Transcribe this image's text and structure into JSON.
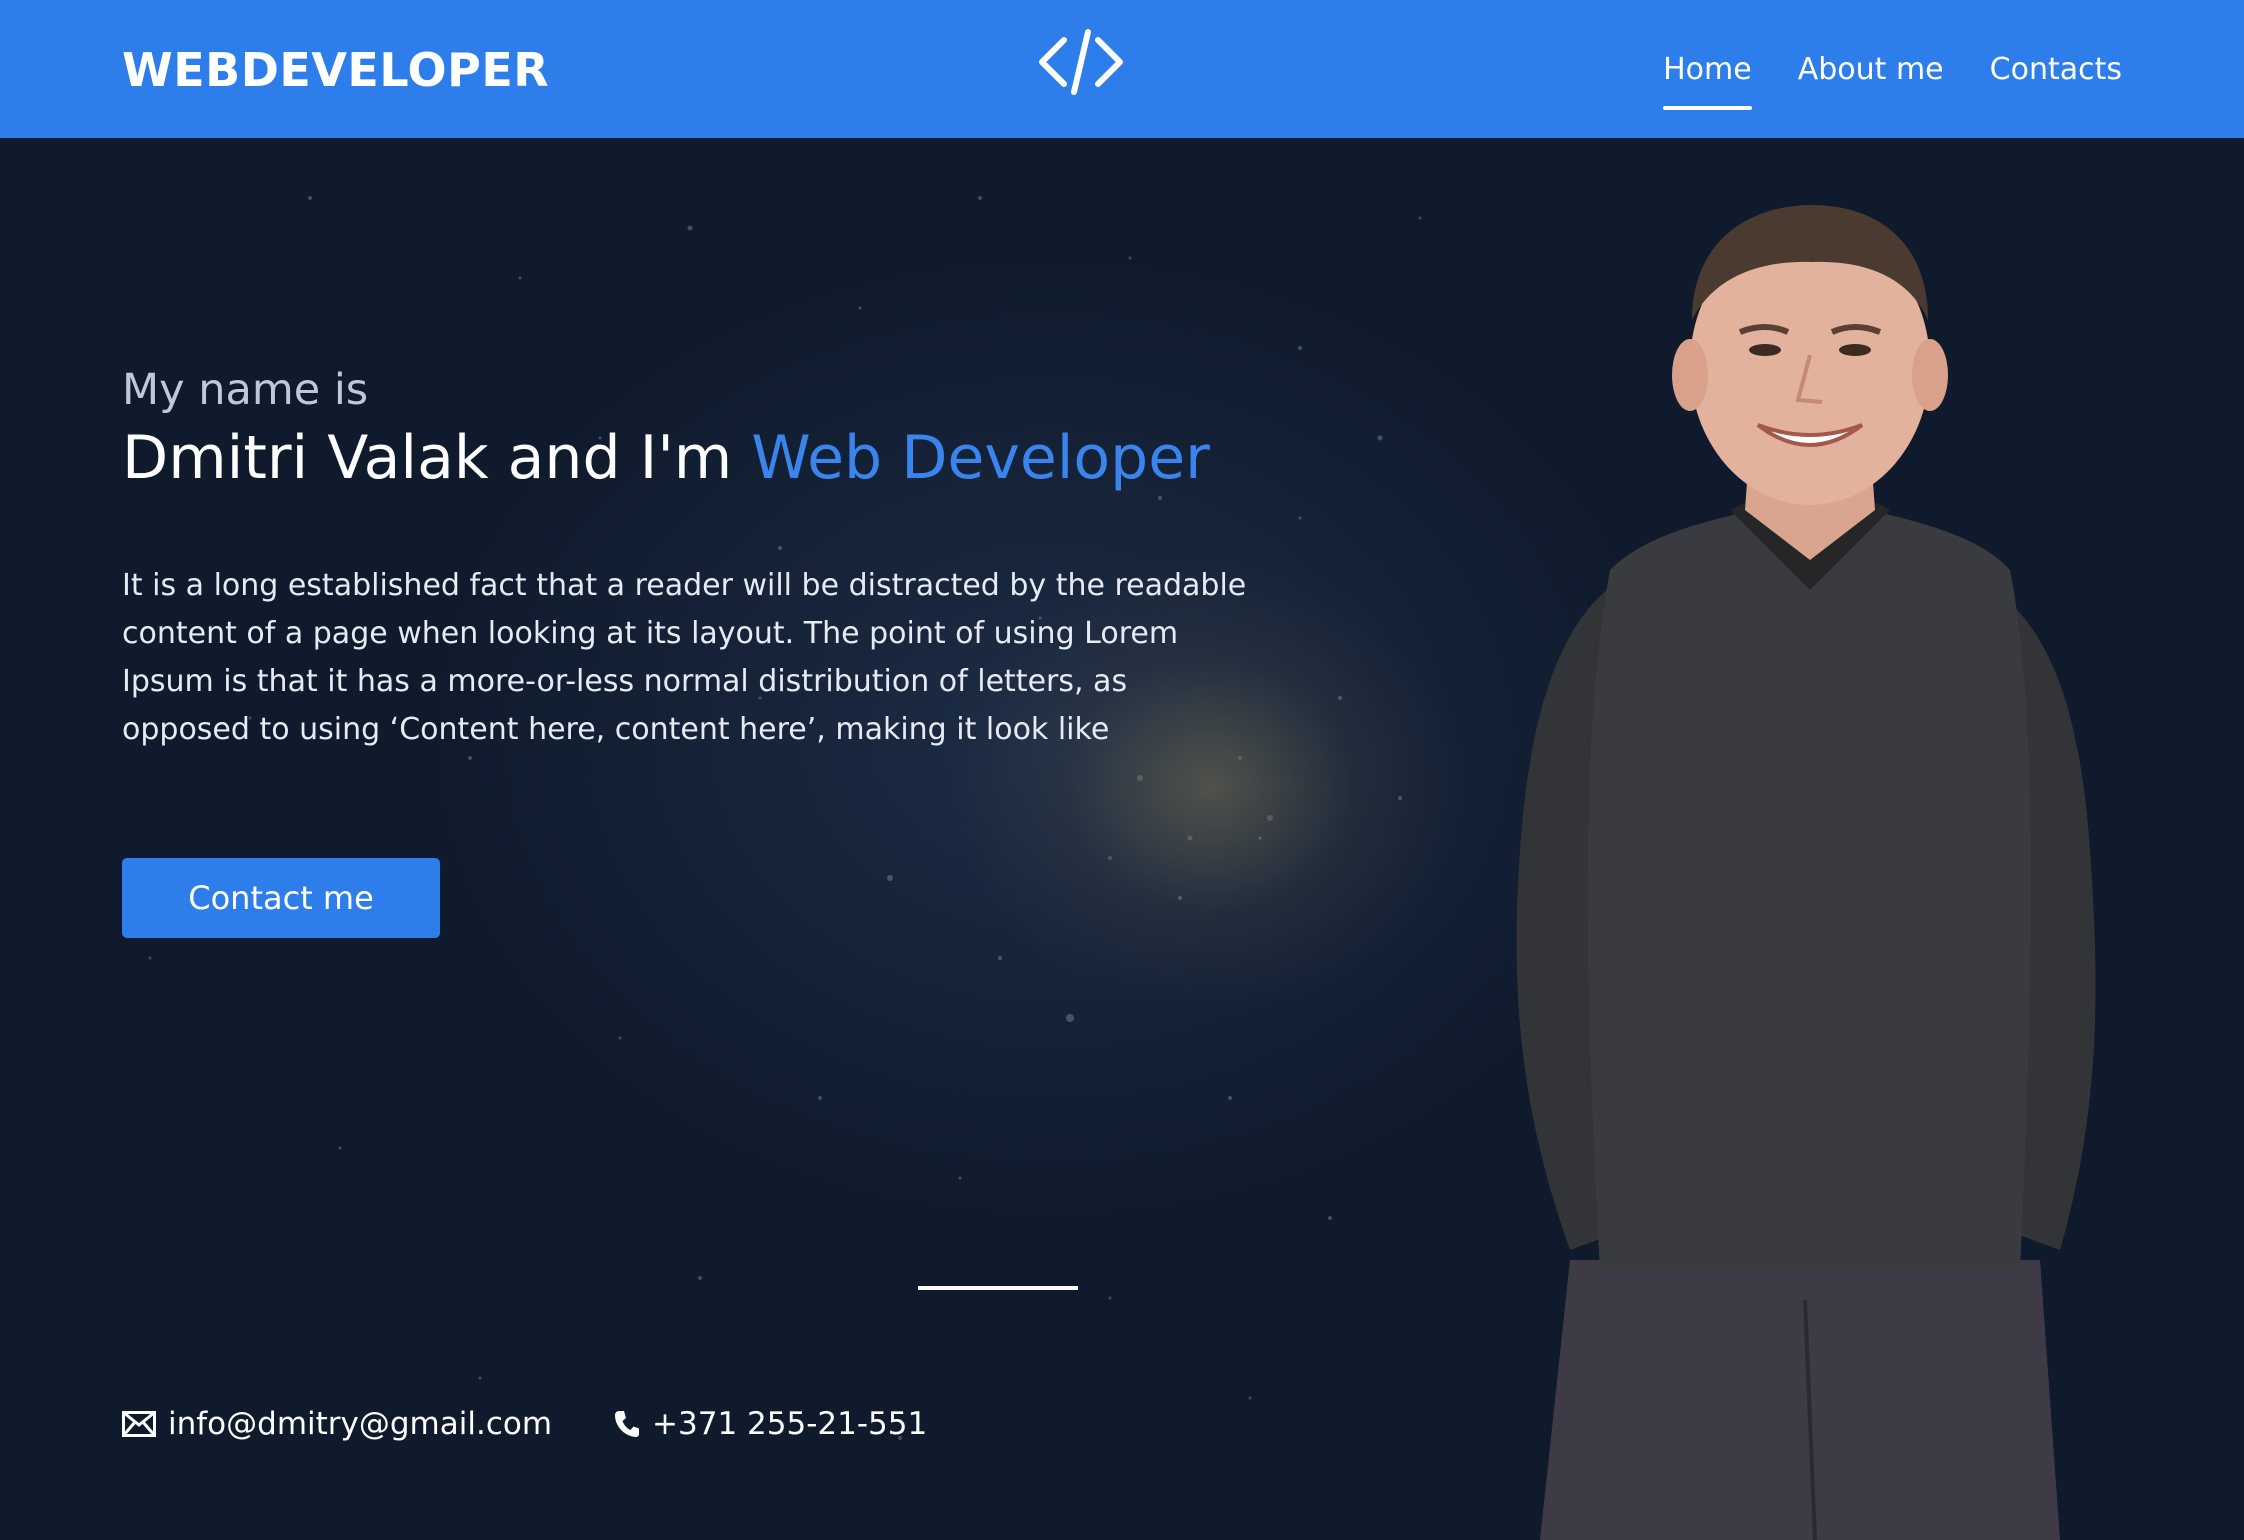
{
  "header": {
    "logo": "WEBDEVELOPER",
    "logo_icon": "code-brackets-icon",
    "nav": [
      {
        "label": "Home",
        "active": true
      },
      {
        "label": "About me",
        "active": false
      },
      {
        "label": "Contacts",
        "active": false
      }
    ]
  },
  "hero": {
    "intro": "My name is",
    "headline_name": "Dmitri Valak and I'm ",
    "headline_role": "Web Developer",
    "description": "It is a long established fact that a reader will be distracted by the readable content of a page when looking at its layout. The point of using Lorem Ipsum is that it has a more-or-less normal distribution of letters, as opposed to using ‘Content here, content here’, making it look like",
    "cta_label": "Contact me"
  },
  "contacts": {
    "email": "info@dmitry@gmail.com",
    "email_icon": "envelope-icon",
    "phone": "+371 255-21-551",
    "phone_icon": "phone-icon"
  },
  "colors": {
    "header_bg": "#2d7eea",
    "accent": "#3a84ee",
    "hero_bg": "#0f1a2c"
  }
}
